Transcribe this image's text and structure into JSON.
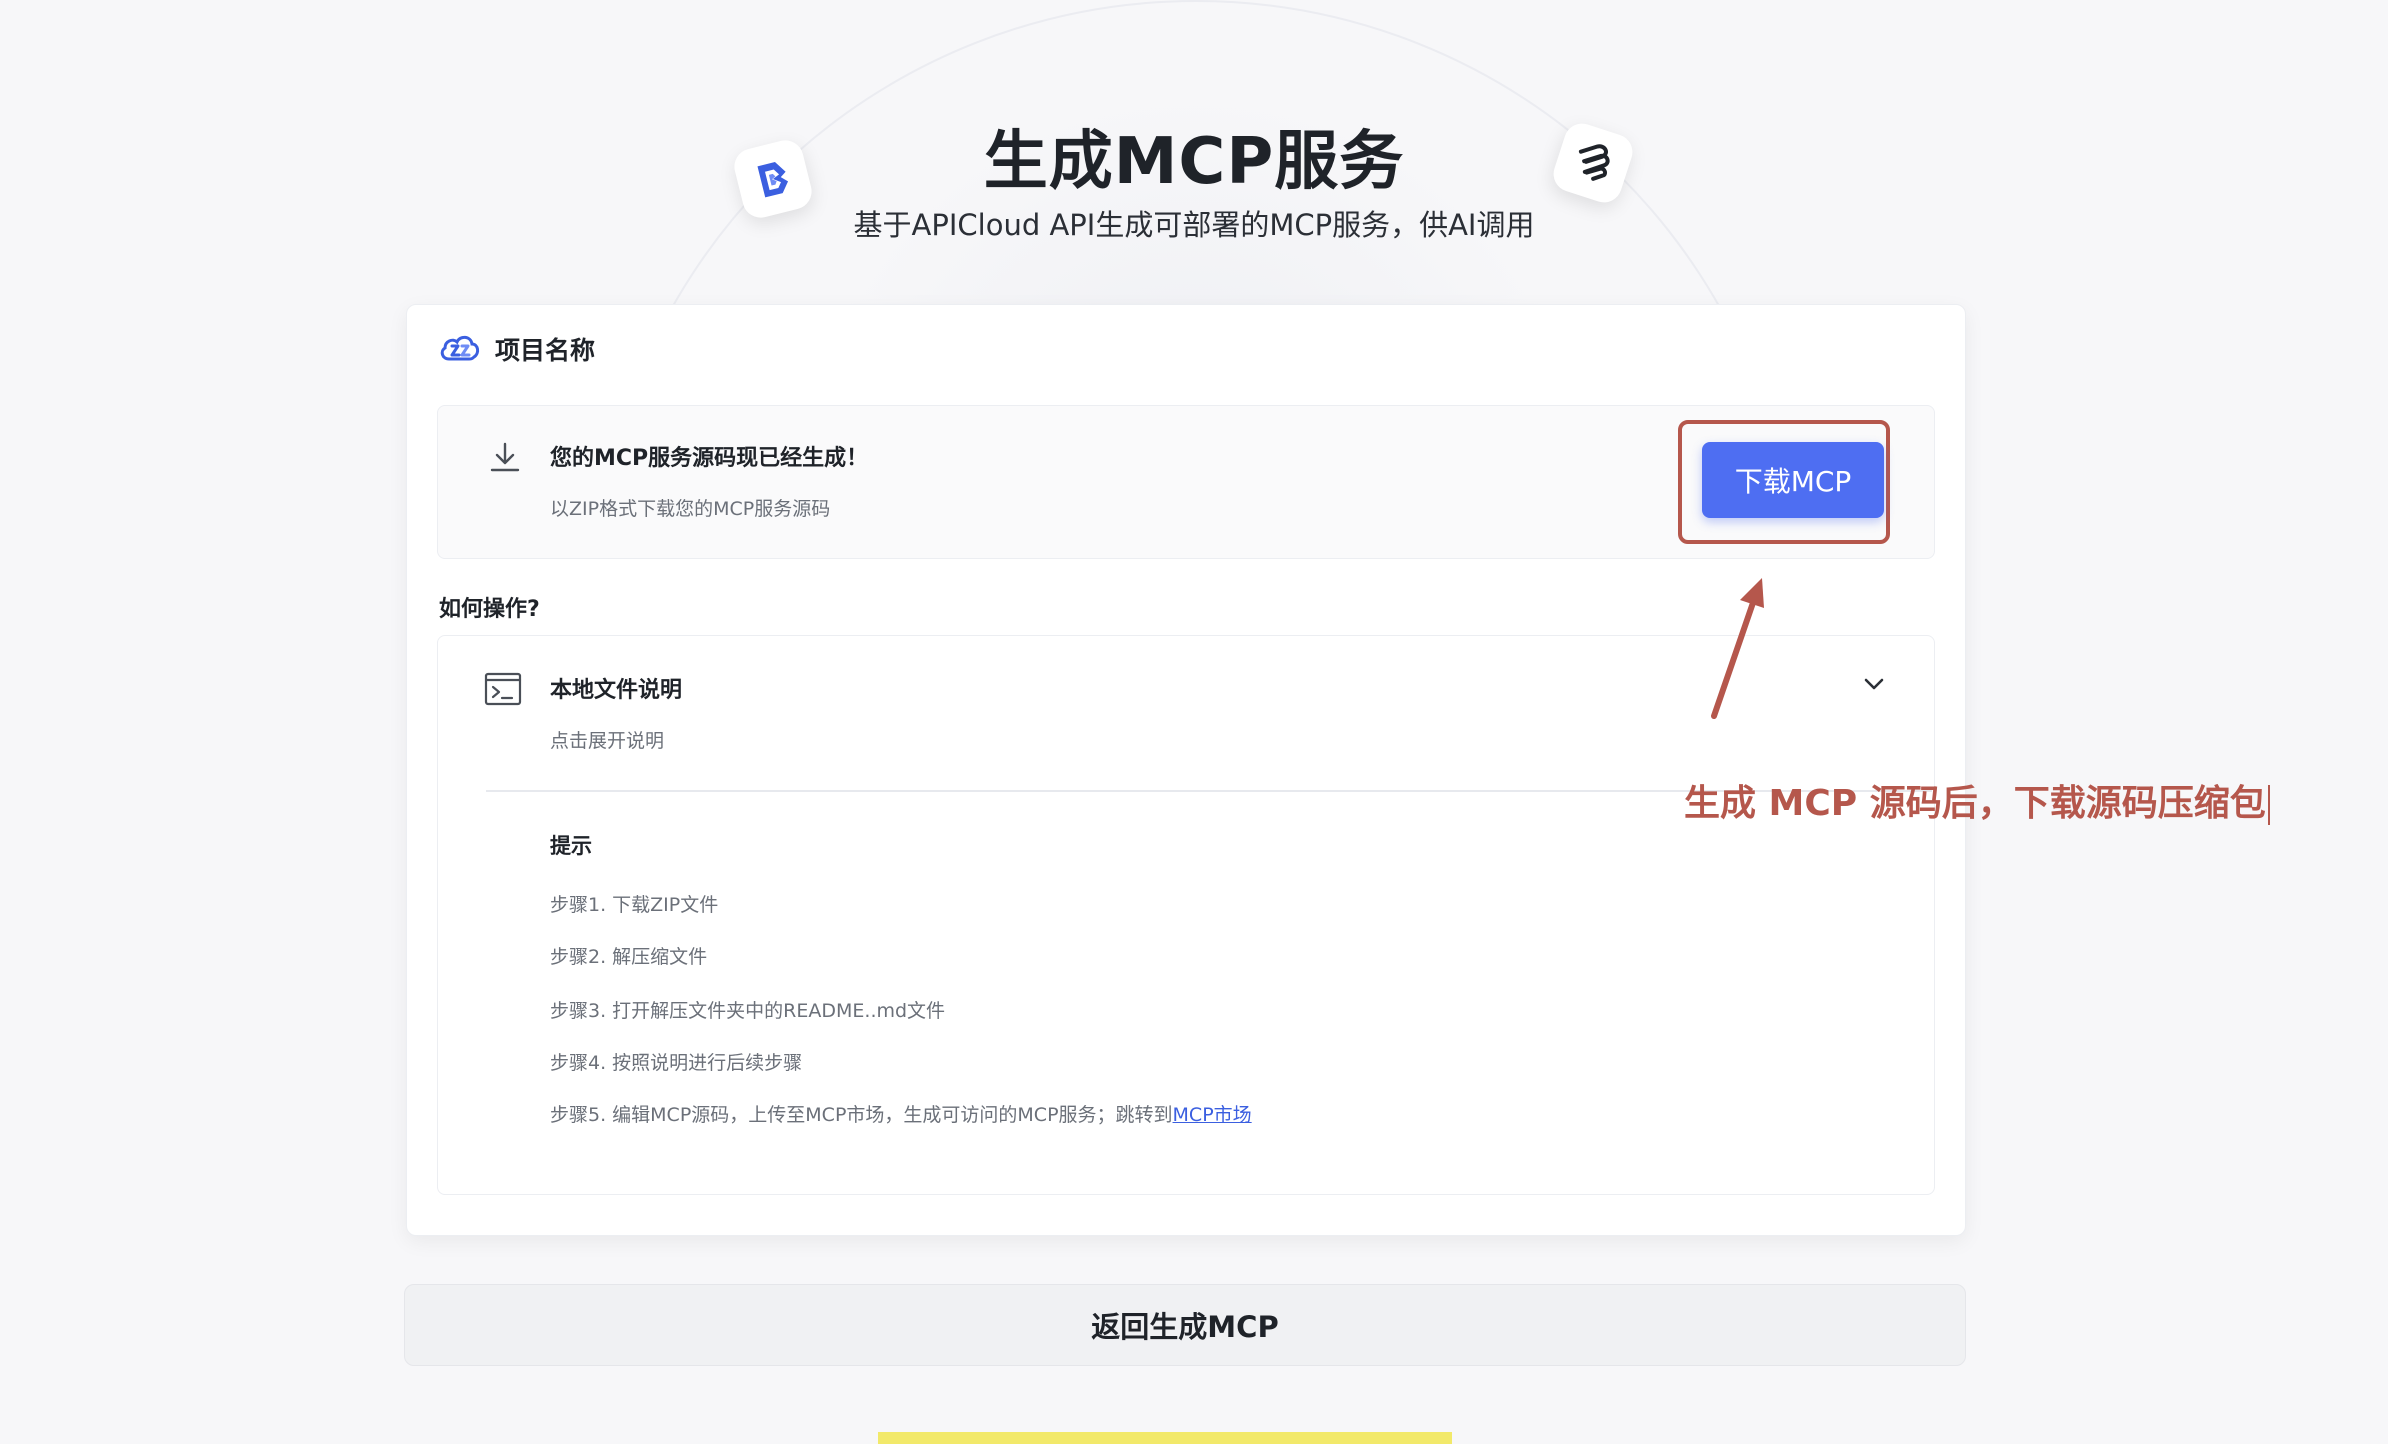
{
  "page": {
    "title": "生成MCP服务",
    "subtitle": "基于APICloud API生成可部署的MCP服务，供AI调用"
  },
  "project": {
    "name": "项目名称"
  },
  "download": {
    "title": "您的MCP服务源码现已经生成！",
    "description": "以ZIP格式下载您的MCP服务源码",
    "button_label": "下载MCP"
  },
  "howto": {
    "label": "如何操作?",
    "guide_title": "本地文件说明",
    "guide_subtitle": "点击展开说明",
    "tip_title": "提示",
    "steps": [
      "步骤1. 下载ZIP文件",
      "步骤2. 解压缩文件",
      "步骤3. 打开解压文件夹中的README..md文件",
      "步骤4. 按照说明进行后续步骤",
      "步骤5. 编辑MCP源码，上传至MCP市场，生成可访问的MCP服务；跳转到"
    ],
    "market_link": "MCP市场"
  },
  "annotation": {
    "text": "生成 MCP 源码后，下载源码压缩包"
  },
  "footer": {
    "back_label": "返回生成MCP"
  },
  "colors": {
    "accent": "#4e6ef2",
    "annotation": "#b5574c",
    "link": "#3b5fe0"
  }
}
